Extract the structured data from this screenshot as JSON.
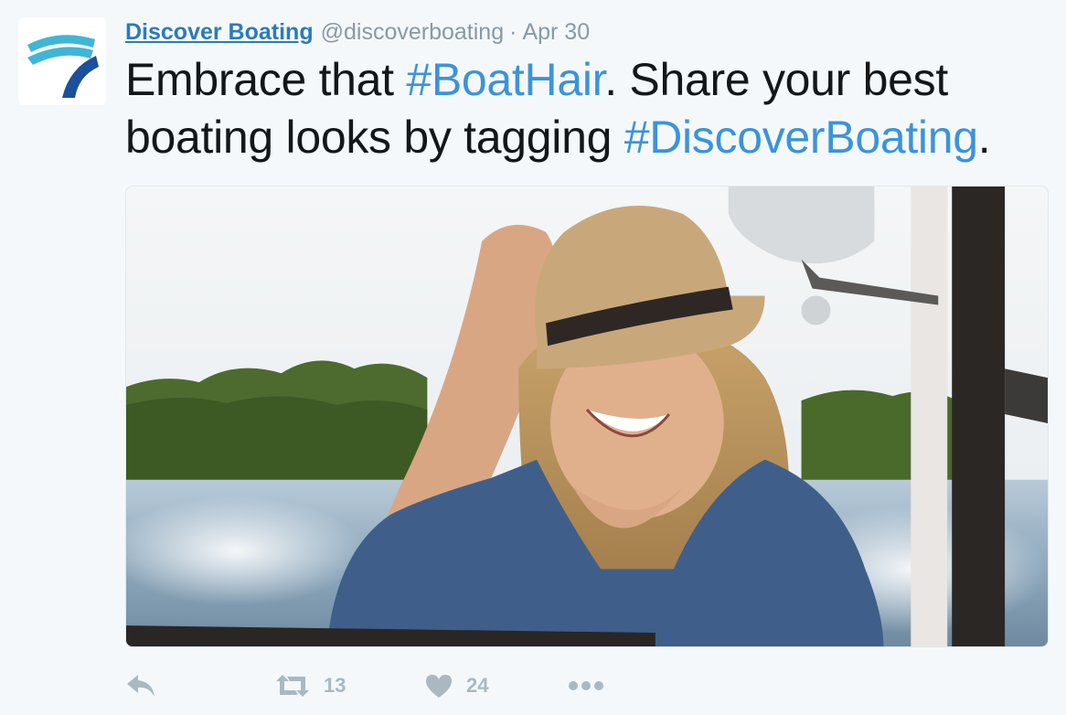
{
  "tweet": {
    "author_name": "Discover Boating",
    "author_handle": "@discoverboating",
    "separator": "·",
    "date": "Apr 30",
    "text_part1": "Embrace that ",
    "hashtag1": "#BoatHair",
    "text_part2": ". Share your best boating looks by tagging ",
    "hashtag2": "#DiscoverBoating",
    "text_part3": "."
  },
  "actions": {
    "retweet_count": "13",
    "like_count": "24"
  },
  "colors": {
    "link": "#2b7bb9",
    "hashtag": "#3b94d9",
    "meta": "#8899a6",
    "action_icon": "#aab8c2",
    "background": "#f5f8fa"
  },
  "icons": {
    "avatar": "discover-boating-logo",
    "reply": "reply-icon",
    "retweet": "retweet-icon",
    "like": "heart-icon",
    "more": "more-icon"
  }
}
